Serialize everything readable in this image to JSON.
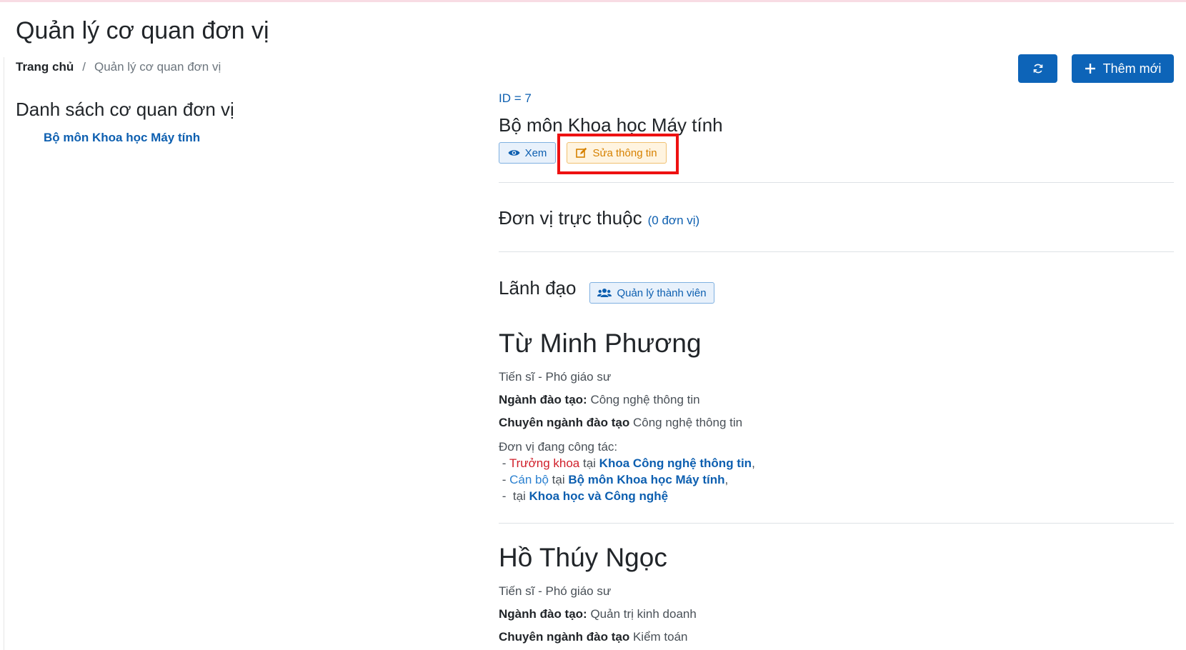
{
  "page": {
    "title": "Quản lý cơ quan đơn vị"
  },
  "breadcrumb": {
    "home": "Trang chủ",
    "separator": "/",
    "current": "Quản lý cơ quan đơn vị"
  },
  "toolbar": {
    "refresh_icon": "refresh-icon",
    "add_icon": "plus-icon",
    "add_label": "Thêm mới"
  },
  "sidebar": {
    "title": "Danh sách cơ quan đơn vị",
    "items": [
      {
        "label": "Bộ môn Khoa học Máy tính"
      }
    ]
  },
  "unit": {
    "id_text": "ID = 7",
    "name": "Bộ môn Khoa học Máy tính",
    "view_label": "Xem",
    "edit_label": "Sửa thông tin"
  },
  "subunits": {
    "heading": "Đơn vị trực thuộc",
    "count": "(0 đơn vị)"
  },
  "leadership": {
    "heading": "Lãnh đạo",
    "members_label": "Quản lý thành viên",
    "people": [
      {
        "name": "Từ Minh Phương",
        "degree": "Tiến sĩ - Phó giáo sư",
        "field_label": "Ngành đào tạo:",
        "field_value": "Công nghệ thông tin",
        "major_label": "Chuyên ngành đào tạo",
        "major_value": "Công nghệ thông tin",
        "workplace_label": "Đơn vị đang công tác:",
        "workplaces": [
          {
            "prefix": "- ",
            "role": "Trưởng khoa",
            "at": " tại ",
            "org": "Khoa Công nghệ thông tin",
            "suffix": ","
          },
          {
            "prefix": "- ",
            "role": "Cán bộ",
            "at": " tại ",
            "org": "Bộ môn Khoa học Máy tính",
            "suffix": ","
          },
          {
            "prefix": "-  ",
            "role": "",
            "at": "tại ",
            "org": "Khoa học và Công nghệ",
            "suffix": ""
          }
        ]
      },
      {
        "name": "Hồ Thúy Ngọc",
        "degree": "Tiến sĩ - Phó giáo sư",
        "field_label": "Ngành đào tạo:",
        "field_value": "Quản trị kinh doanh",
        "major_label": "Chuyên ngành đào tạo",
        "major_value": "Kiểm toán"
      }
    ]
  },
  "colors": {
    "primary": "#0d64b8",
    "link": "#0d5fb0",
    "warning": "#d68100",
    "highlight": "#ee1111",
    "role_red": "#d01f2a"
  }
}
